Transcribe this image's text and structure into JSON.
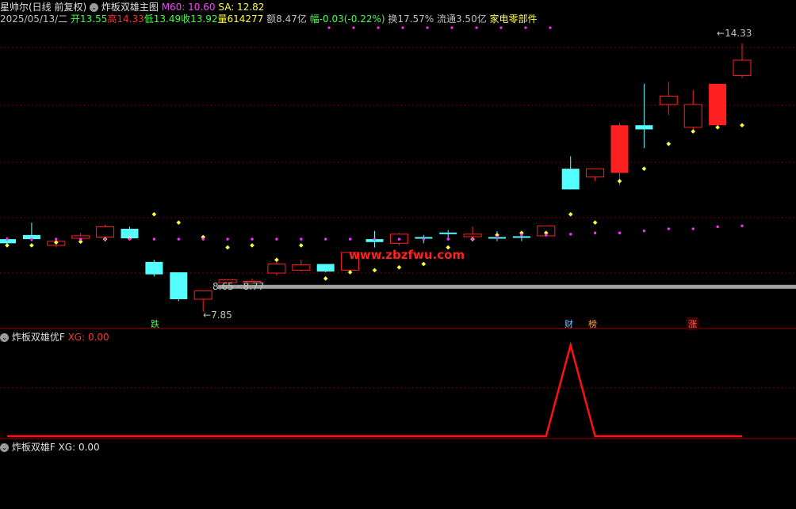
{
  "header": {
    "stock_name": "星帅尔(日线 前复权)",
    "indicator_name": "炸板双雄主图",
    "m60_label": "M60: 10.60",
    "sa_label": "SA: 12.82",
    "date": "2025/05/13/二",
    "open": "开13.55",
    "high": "高14.33",
    "low": "低13.49",
    "close": "收13.92",
    "volume": "量614277",
    "amount": "额8.47亿",
    "change": "幅-0.03(-0.22%)",
    "turnover": "换17.57%",
    "float_cap": "流通3.50亿",
    "sector": "家电零部件"
  },
  "annotations": {
    "high_price": "14.33",
    "low_price": "7.85",
    "zone": "8.65 - 8.77",
    "watermark": "www.zbzfwu.com"
  },
  "badges": {
    "b1": "跌",
    "b2": "财",
    "b3": "榜",
    "b4": "涨"
  },
  "sub1": {
    "name": "炸板双雄优F",
    "value": "XG: 0.00"
  },
  "sub2": {
    "name": "炸板双雄F",
    "value": "XG: 0.00"
  },
  "colors": {
    "up": "#ff2020",
    "down": "#54ffff",
    "dot_yellow": "#ffff40",
    "dot_magenta": "#ff30ff",
    "grid": "#800000",
    "support": "#a0a0a0",
    "signal": "#ff1010"
  },
  "chart_data": {
    "type": "candlestick",
    "ylim": [
      7.5,
      14.8
    ],
    "candles": [
      {
        "o": 9.6,
        "h": 9.65,
        "l": 9.45,
        "c": 9.5
      },
      {
        "o": 9.7,
        "h": 10.0,
        "l": 9.55,
        "c": 9.6
      },
      {
        "o": 9.45,
        "h": 9.6,
        "l": 9.4,
        "c": 9.55
      },
      {
        "o": 9.62,
        "h": 9.75,
        "l": 9.58,
        "c": 9.68
      },
      {
        "o": 9.65,
        "h": 9.95,
        "l": 9.62,
        "c": 9.9
      },
      {
        "o": 9.85,
        "h": 9.9,
        "l": 9.58,
        "c": 9.62
      },
      {
        "o": 9.05,
        "h": 9.1,
        "l": 8.7,
        "c": 8.75
      },
      {
        "o": 8.8,
        "h": 8.8,
        "l": 8.1,
        "c": 8.15
      },
      {
        "o": 8.15,
        "h": 8.3,
        "l": 7.85,
        "c": 8.35
      },
      {
        "o": 8.55,
        "h": 8.62,
        "l": 8.52,
        "c": 8.62
      },
      {
        "o": 8.55,
        "h": 8.65,
        "l": 8.52,
        "c": 8.58
      },
      {
        "o": 8.78,
        "h": 9.05,
        "l": 8.72,
        "c": 9.0
      },
      {
        "o": 8.85,
        "h": 9.1,
        "l": 8.82,
        "c": 8.98
      },
      {
        "o": 9.0,
        "h": 9.0,
        "l": 8.8,
        "c": 8.82
      },
      {
        "o": 8.85,
        "h": 9.3,
        "l": 8.84,
        "c": 9.28
      },
      {
        "o": 9.6,
        "h": 9.8,
        "l": 9.4,
        "c": 9.53
      },
      {
        "o": 9.5,
        "h": 9.75,
        "l": 9.45,
        "c": 9.72
      },
      {
        "o": 9.65,
        "h": 9.7,
        "l": 9.5,
        "c": 9.62
      },
      {
        "o": 9.76,
        "h": 9.82,
        "l": 9.63,
        "c": 9.74
      },
      {
        "o": 9.66,
        "h": 9.9,
        "l": 9.62,
        "c": 9.72
      },
      {
        "o": 9.65,
        "h": 9.79,
        "l": 9.55,
        "c": 9.63
      },
      {
        "o": 9.67,
        "h": 9.76,
        "l": 9.55,
        "c": 9.65
      },
      {
        "o": 9.68,
        "h": 9.9,
        "l": 9.66,
        "c": 9.92
      },
      {
        "o": 11.3,
        "h": 11.6,
        "l": 10.8,
        "c": 10.8
      },
      {
        "o": 11.1,
        "h": 11.3,
        "l": 11.0,
        "c": 11.3
      },
      {
        "o": 12.35,
        "h": 12.4,
        "l": 10.9,
        "c": 11.2
      },
      {
        "o": 12.35,
        "h": 13.35,
        "l": 11.8,
        "c": 12.25
      },
      {
        "o": 12.85,
        "h": 13.4,
        "l": 12.6,
        "c": 13.05
      },
      {
        "o": 12.3,
        "h": 13.2,
        "l": 12.2,
        "c": 12.85
      },
      {
        "o": 13.35,
        "h": 13.35,
        "l": 12.35,
        "c": 12.35
      },
      {
        "o": 13.55,
        "h": 14.33,
        "l": 13.49,
        "c": 13.92
      }
    ],
    "dots_yellow": [
      9.45,
      9.45,
      9.52,
      9.54,
      9.6,
      9.62,
      10.2,
      10.0,
      9.65,
      9.4,
      9.45,
      9.1,
      9.45,
      8.65,
      8.8,
      8.85,
      8.92,
      9.0,
      9.4,
      9.6,
      9.7,
      9.75,
      9.75,
      10.2,
      10.0,
      11.0,
      11.3,
      11.9,
      12.2,
      12.3,
      12.35
    ],
    "dots_magenta": [
      9.6,
      9.6,
      9.6,
      9.6,
      9.6,
      9.6,
      9.6,
      9.6,
      9.6,
      9.6,
      9.6,
      9.6,
      9.6,
      9.6,
      9.6,
      9.6,
      9.6,
      9.6,
      9.6,
      9.6,
      9.65,
      9.7,
      9.7,
      9.72,
      9.75,
      9.75,
      9.8,
      9.85,
      9.85,
      9.9,
      9.92
    ],
    "top_dots": 10,
    "support_price": 8.45,
    "signal_sub1": [
      0,
      0,
      0,
      0,
      0,
      0,
      0,
      0,
      0,
      0,
      0,
      0,
      0,
      0,
      0,
      0,
      0,
      0,
      0,
      0,
      0,
      0,
      0,
      1,
      0,
      0,
      0,
      0,
      0,
      0,
      0
    ]
  }
}
